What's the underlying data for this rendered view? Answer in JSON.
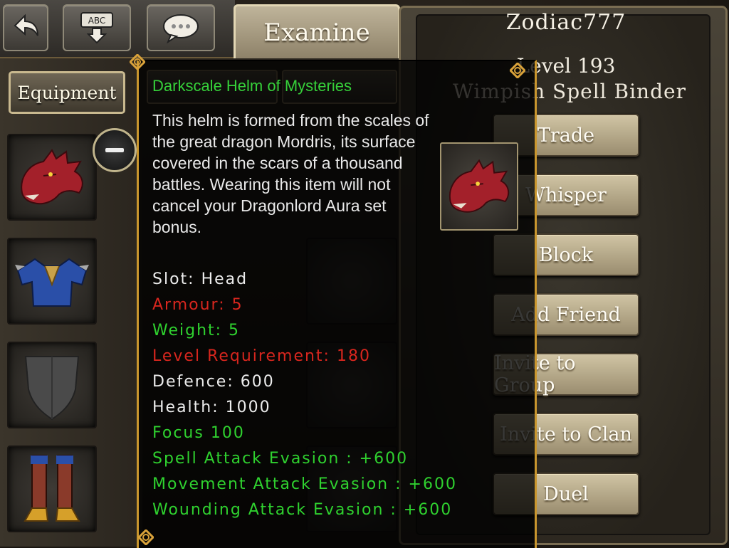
{
  "toolbar": {
    "back_icon": "back-arrow-icon",
    "text_icon": "abc-text-input-icon",
    "chat_icon": "speech-bubble-icon",
    "abc_label": "ABC"
  },
  "tab": {
    "label": "Examine"
  },
  "left_panel": {
    "equipment_label": "Equipment",
    "slots": [
      "dragon-helm-icon",
      "blue-armour-icon",
      "shield-icon",
      "boots-icon"
    ]
  },
  "player": {
    "name": "Zodiac777",
    "level": "Level 193",
    "title": "Wimpish Spell Binder"
  },
  "actions": [
    "Trade",
    "Whisper",
    "Block",
    "Add Friend",
    "Invite to Group",
    "Invite to Clan",
    "Duel"
  ],
  "tooltip": {
    "item_name": "Darkscale Helm of Mysteries",
    "description": "This helm is formed from the scales of the great dragon Mordris, its surface covered in the scars of a thousand battles. Wearing this item will not cancel your Dragonlord Aura set bonus.",
    "stats": [
      {
        "text": "Slot: Head",
        "color": "white"
      },
      {
        "text": "Armour: 5",
        "color": "red"
      },
      {
        "text": "Weight: 5",
        "color": "green"
      },
      {
        "text": "Level Requirement: 180",
        "color": "red"
      },
      {
        "text": "Defence: 600",
        "color": "white"
      },
      {
        "text": "Health: 1000",
        "color": "white"
      },
      {
        "text": "Focus 100",
        "color": "green"
      },
      {
        "text": "Spell Attack Evasion : +600",
        "color": "green"
      },
      {
        "text": "Movement Attack Evasion : +600",
        "color": "green"
      },
      {
        "text": "Wounding Attack Evasion : +600",
        "color": "green"
      }
    ]
  },
  "colors": {
    "stat_white": "#ececec",
    "stat_red": "#d8261e",
    "stat_green": "#2fd12f",
    "tooltip_border": "#c9962e"
  }
}
